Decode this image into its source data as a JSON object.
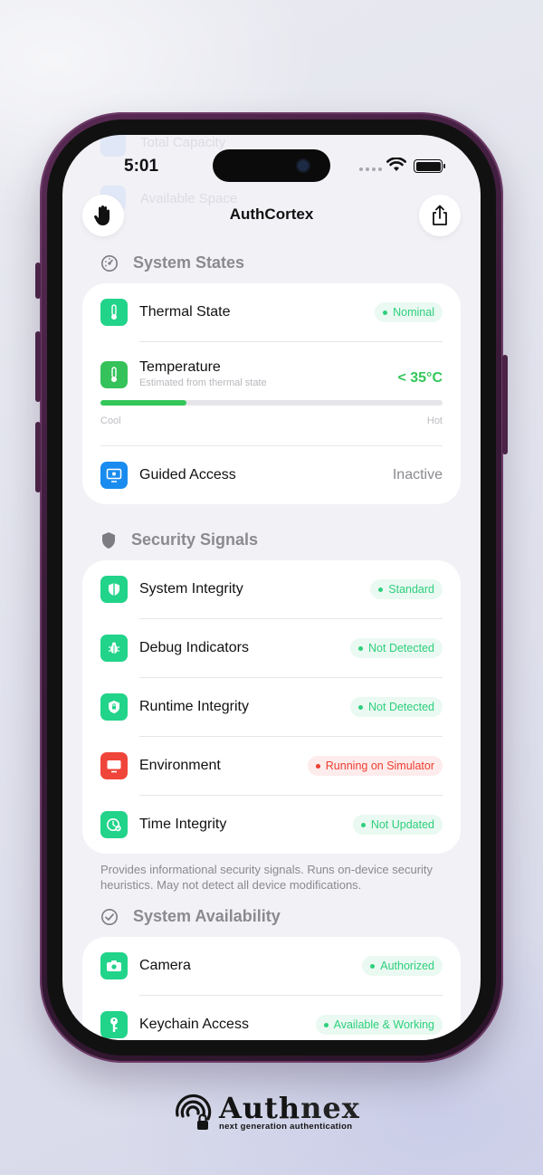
{
  "status_bar": {
    "time": "5:01"
  },
  "nav": {
    "title": "AuthCortex"
  },
  "ghost_rows": [
    "Total Capacity",
    "Available Space"
  ],
  "system_states": {
    "title": "System States",
    "thermal": {
      "label": "Thermal State",
      "status": "Nominal"
    },
    "temperature": {
      "label": "Temperature",
      "sub": "Estimated from thermal state",
      "value": "< 35°C",
      "level_fraction": 0.25,
      "low_label": "Cool",
      "high_label": "Hot"
    },
    "guided_access": {
      "label": "Guided Access",
      "value": "Inactive"
    }
  },
  "security_signals": {
    "title": "Security Signals",
    "rows": [
      {
        "label": "System Integrity",
        "status": "Standard",
        "tone": "green"
      },
      {
        "label": "Debug Indicators",
        "status": "Not Detected",
        "tone": "green"
      },
      {
        "label": "Runtime Integrity",
        "status": "Not Detected",
        "tone": "green"
      },
      {
        "label": "Environment",
        "status": "Running on Simulator",
        "tone": "red"
      },
      {
        "label": "Time Integrity",
        "status": "Not Updated",
        "tone": "green"
      }
    ],
    "footnote": "Provides informational security signals. Runs on-device security heuristics. May not detect all device modifications."
  },
  "system_availability": {
    "title": "System Availability",
    "rows": [
      {
        "label": "Camera",
        "status": "Authorized"
      },
      {
        "label": "Keychain Access",
        "status": "Available & Working"
      }
    ]
  },
  "brand": {
    "name_a": "Auth",
    "name_b": "nex",
    "tagline": "next generation authentication"
  },
  "colors": {
    "accent_green": "#2ecf7e",
    "alert_red": "#ef3b31",
    "blue": "#1a8cf0",
    "frame": "#3a1b39"
  }
}
